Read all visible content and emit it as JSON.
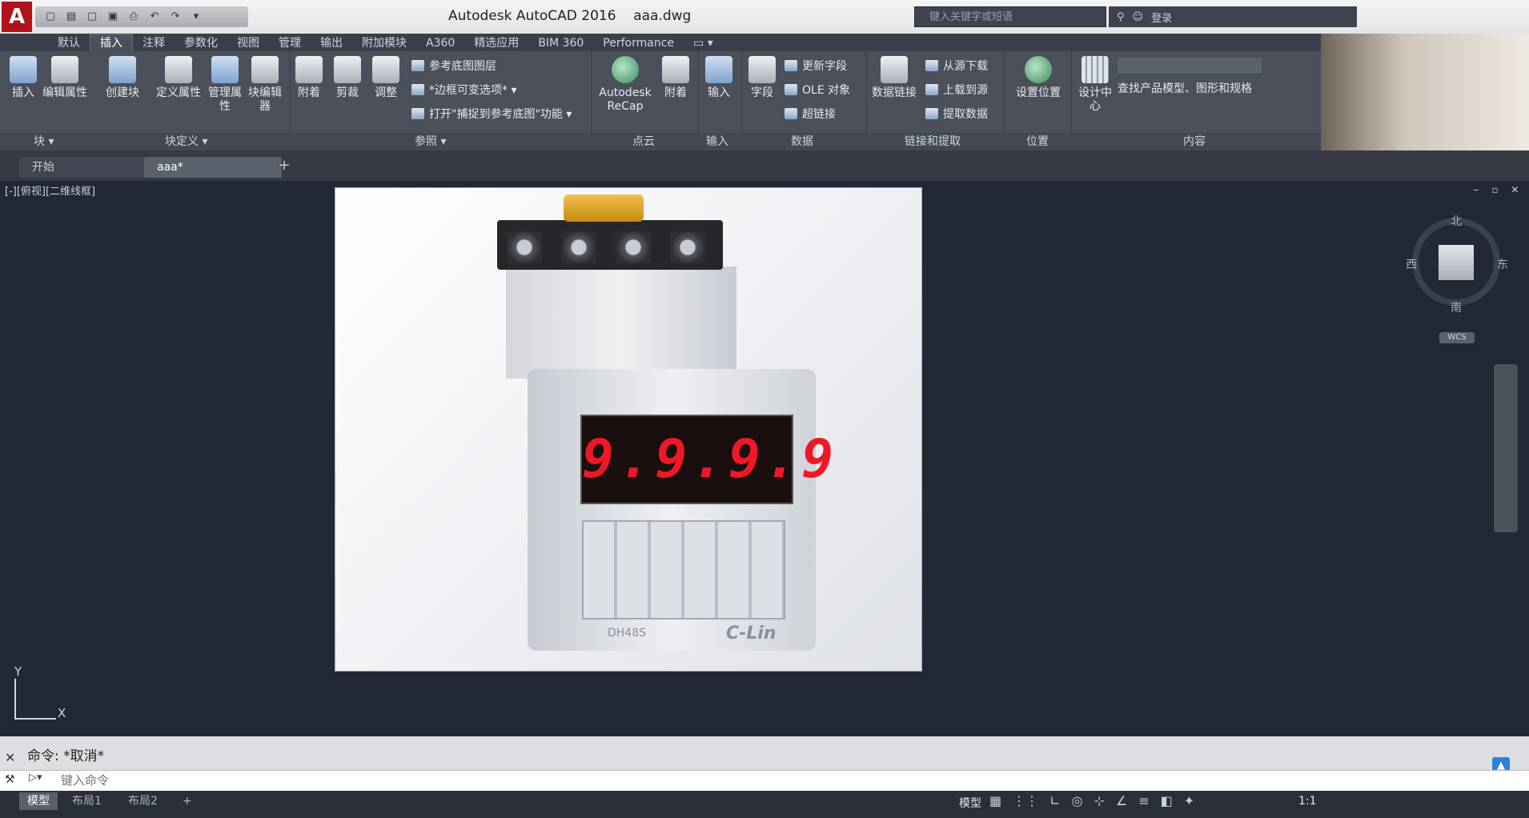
{
  "window": {
    "title": "Autodesk AutoCAD 2016",
    "file": "aaa.dwg"
  },
  "qat": [
    "▢",
    "▤",
    "▢",
    "▣",
    "⎙",
    "↶",
    "↷",
    "▾"
  ],
  "search": {
    "placeholder": "键入关键字或短语"
  },
  "header": {
    "user": "登录"
  },
  "ribbon_tabs": [
    "默认",
    "插入",
    "注释",
    "参数化",
    "视图",
    "管理",
    "输出",
    "附加模块",
    "A360",
    "精选应用",
    "BIM 360",
    "Performance"
  ],
  "active_tab": "插入",
  "ribbon": {
    "insert": "插入",
    "edit_attr": "编辑属性",
    "create_block": "创建块",
    "define_attr": "定义属性",
    "manage_attr": "管理属性",
    "block_editor": "块编辑器",
    "attach": "附着",
    "clip": "剪裁",
    "adjust": "调整",
    "underlay_layers": "参考底图图层",
    "frames_vary": "*边框可变选项*",
    "snap_underlay": "打开\"捕捉到参考底图\"功能",
    "recap": "Autodesk ReCap",
    "attach2": "附着",
    "import": "输入",
    "field": "字段",
    "update_fields": "更新字段",
    "ole": "OLE 对象",
    "hyperlink": "超链接",
    "data_link": "数据链接",
    "download_source": "从源下载",
    "upload_source": "上载到源",
    "extract_data": "提取数据",
    "set_location": "设置位置",
    "design_center": "设计中心",
    "seek": "查找产品模型、图形和规格"
  },
  "ribbon_panels": [
    "块",
    "块定义",
    "参照",
    "点云",
    "输入",
    "数据",
    "链接和提取",
    "位置",
    "内容"
  ],
  "file_tabs": [
    "开始",
    "aaa*"
  ],
  "view_label": "[-][俯视][二维线框]",
  "device": {
    "display": "9.9.9.9",
    "brand": "C-Lin",
    "model": "DH48S"
  },
  "compass": {
    "north": "北",
    "south": "南",
    "east": "东",
    "west": "西",
    "wcs": "WCS"
  },
  "ucs": {
    "x": "X",
    "y": "Y"
  },
  "command": {
    "history": "命令: *取消*",
    "placeholder": "键入命令"
  },
  "layout_tabs": [
    "模型",
    "布局1",
    "布局2",
    "+"
  ],
  "status": {
    "model": "模型",
    "scale": "1:1"
  }
}
